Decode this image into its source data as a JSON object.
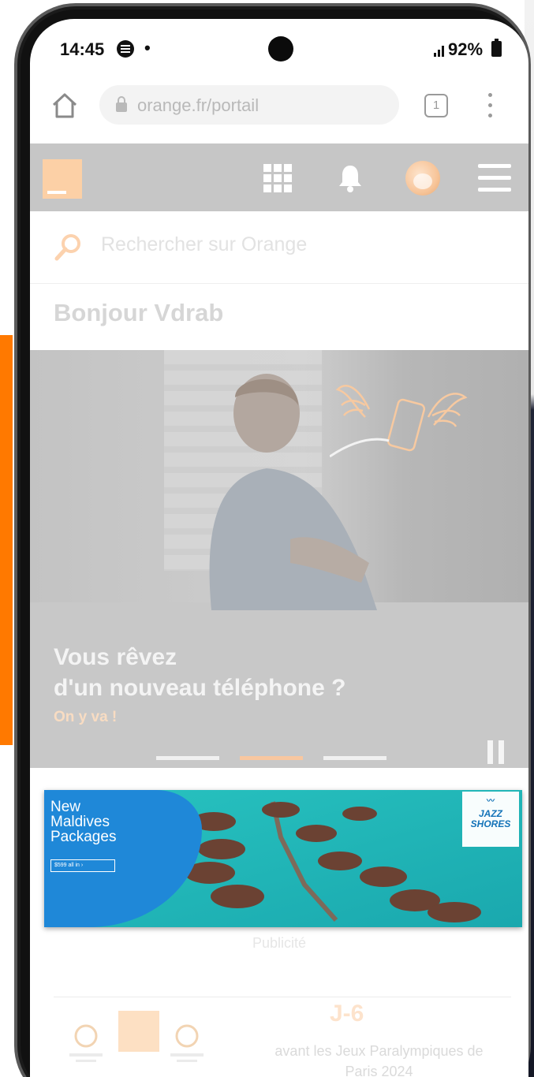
{
  "status_bar": {
    "time": "14:45",
    "dot": "•",
    "battery": "92%"
  },
  "browser": {
    "url": "orange.fr/portail",
    "tab_count": "1"
  },
  "header": {
    "icons": [
      "orange-logo",
      "apps-grid-icon",
      "bell-icon",
      "avatar",
      "hamburger-icon"
    ]
  },
  "search": {
    "placeholder": "Rechercher sur Orange"
  },
  "greeting": "Bonjour Vdrab",
  "hero": {
    "title_line1": "Vous rêvez",
    "title_line2": "d'un nouveau téléphone ?",
    "cta": "On y va !",
    "slide_count": 3,
    "active_slide": 2
  },
  "ad": {
    "line1": "New",
    "line2": "Maldives",
    "line3": "Packages",
    "cta": "$599 all in   ›",
    "brand_line1": "JAZZ",
    "brand_line2": "SHORES",
    "label": "Publicité"
  },
  "olympics": {
    "countdown": "J-6",
    "text_line1": "avant les Jeux Paralympiques de",
    "text_line2": "Paris 2024"
  },
  "colors": {
    "orange": "#ff7900",
    "header_grey": "#c6c6c6",
    "ad_blue": "#1f88d8"
  }
}
